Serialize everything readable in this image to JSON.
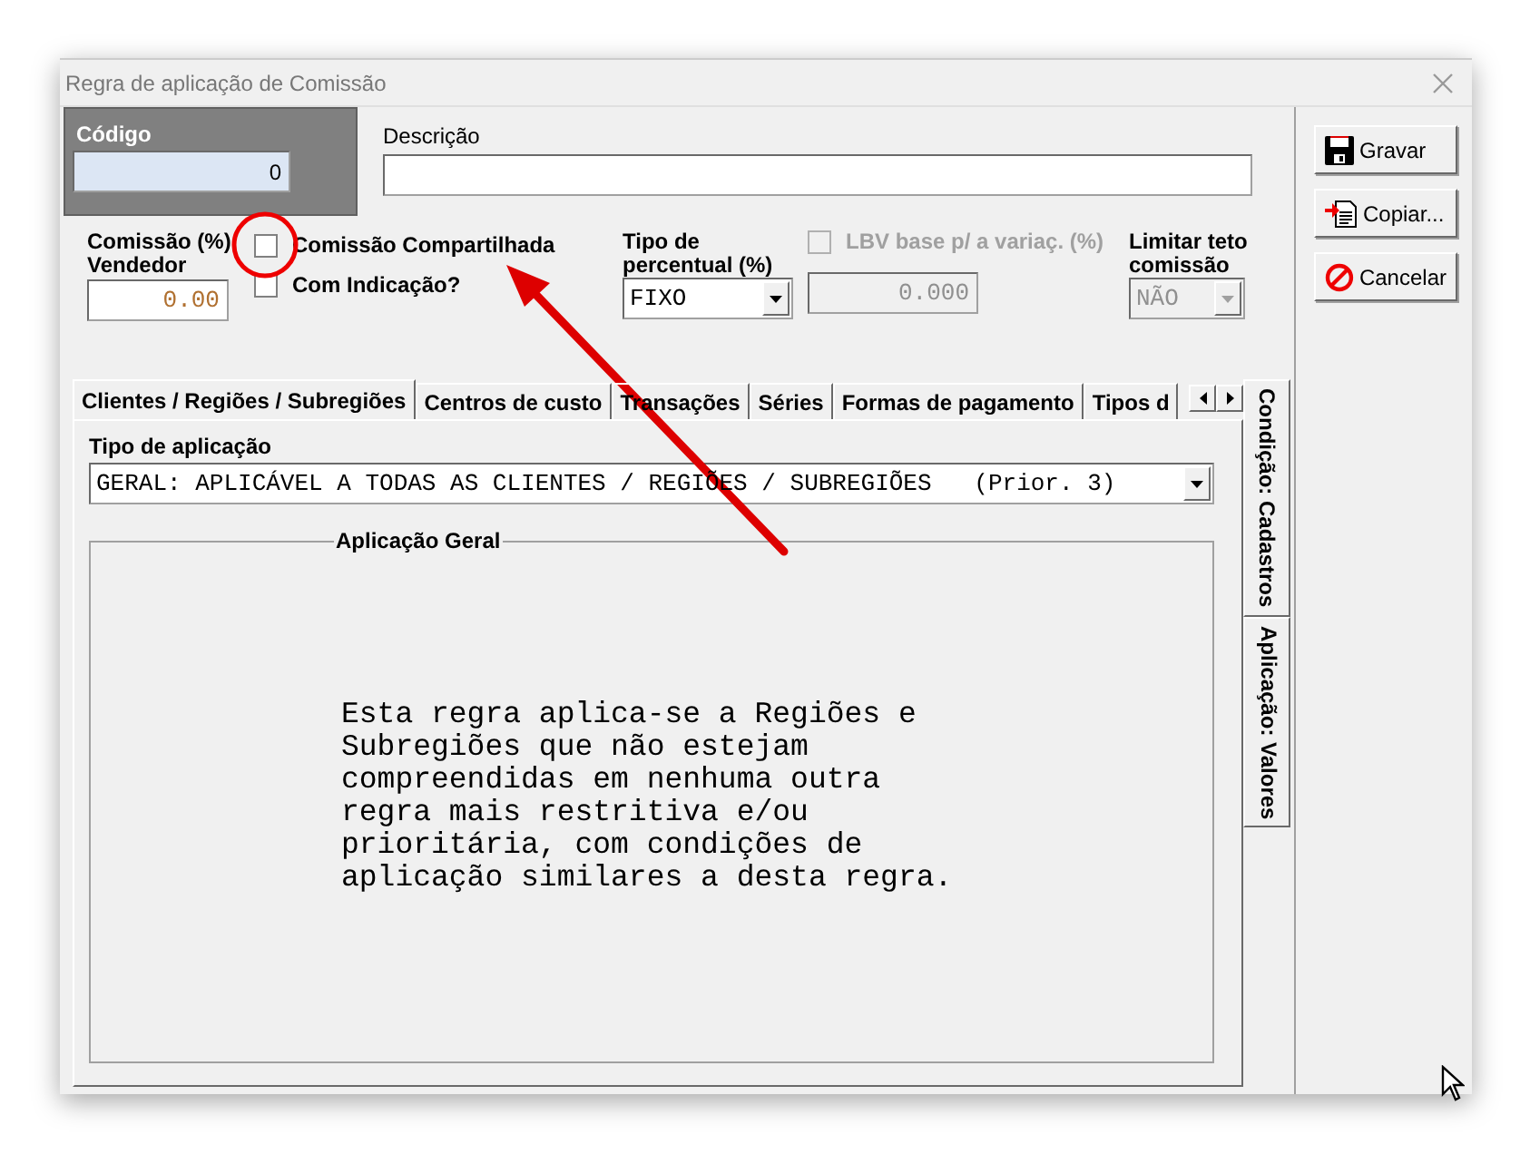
{
  "window": {
    "title": "Regra de aplicação de Comissão"
  },
  "codigo": {
    "label": "Código",
    "value": "0"
  },
  "descricao": {
    "label": "Descrição"
  },
  "comissao": {
    "label_line1": "Comissão (%)",
    "label_line2": "Vendedor",
    "value": "0.00"
  },
  "checkboxes": [
    {
      "label": "Comissão Compartilhada",
      "checked": false,
      "disabled": false
    },
    {
      "label": "Com Indicação?",
      "checked": false,
      "disabled": false
    }
  ],
  "tipo_percentual": {
    "label_line1": "Tipo de",
    "label_line2": "percentual (%)",
    "value": "FIXO",
    "disabled": false
  },
  "lbv": {
    "label": "LBV base p/ a variaç. (%)",
    "checked": false,
    "disabled": true,
    "value": "0.000"
  },
  "limitar_teto": {
    "label_line1": "Limitar teto",
    "label_line2": "comissão",
    "value": "NÃO",
    "disabled": true
  },
  "buttons": [
    {
      "kind": "save",
      "label": "Gravar"
    },
    {
      "kind": "copy",
      "label": "Copiar..."
    },
    {
      "kind": "cancel",
      "label": "Cancelar"
    }
  ],
  "tabs": [
    {
      "label": "Clientes / Regiões / Subregiões",
      "selected": true
    },
    {
      "label": "Centros de custo",
      "selected": false
    },
    {
      "label": "Transações",
      "selected": false
    },
    {
      "label": "Séries",
      "selected": false
    },
    {
      "label": "Formas de pagamento",
      "selected": false
    },
    {
      "label": "Tipos d",
      "selected": false
    }
  ],
  "side_tabs": [
    {
      "label": "Condição: Cadastros",
      "selected": true
    },
    {
      "label": "Aplicação: Valores",
      "selected": false
    }
  ],
  "tipo_aplicacao": {
    "label": "Tipo de aplicação",
    "value": "GERAL: APLICÁVEL A TODAS AS CLIENTES / REGIÕES / SUBREGIÕES   (Prior. 3)"
  },
  "group": {
    "title": "Aplicação Geral",
    "text": "Esta regra aplica-se a Regiões e Subregiões que não estejam compreendidas em nenhuma outra regra mais restritiva e/ou prioritária, com condições de aplicação similares a desta regra."
  }
}
